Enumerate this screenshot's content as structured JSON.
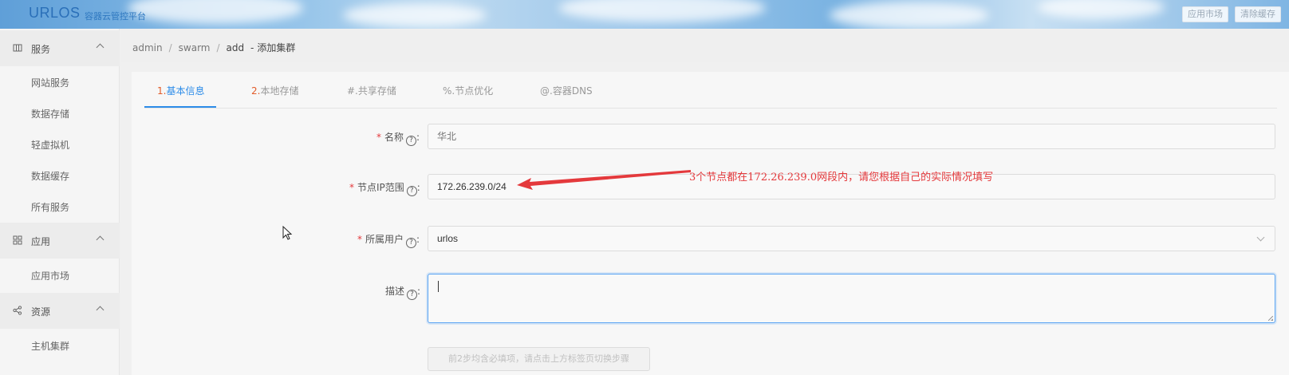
{
  "header": {
    "logo": "URLOS",
    "subtitle": "容器云管控平台",
    "buttons": [
      "应用市场",
      "清除缓存"
    ]
  },
  "sidebar": {
    "groups": [
      {
        "label": "服务",
        "icon": "service-icon",
        "items": [
          "网站服务",
          "数据存储",
          "轻虚拟机",
          "数据缓存",
          "所有服务"
        ]
      },
      {
        "label": "应用",
        "icon": "grid-icon",
        "items": [
          "应用市场"
        ]
      },
      {
        "label": "资源",
        "icon": "share-nodes-icon",
        "items": [
          "主机集群"
        ]
      }
    ]
  },
  "breadcrumb": {
    "items": [
      "admin",
      "swarm",
      "add"
    ],
    "current": "添加集群",
    "dash": "-"
  },
  "tabs": [
    {
      "num": "1.",
      "label": "基本信息",
      "active": true
    },
    {
      "num": "2.",
      "label": "本地存储",
      "active": false
    },
    {
      "num": "#.",
      "label": "共享存储",
      "active": false
    },
    {
      "num": "%.",
      "label": "节点优化",
      "active": false
    },
    {
      "num": "@.",
      "label": "容器DNS",
      "active": false
    }
  ],
  "form": {
    "name": {
      "label": "名称",
      "required": "*",
      "placeholder": "华北"
    },
    "ip_range": {
      "label": "节点IP范围",
      "required": "*",
      "value": "172.26.239.0/24"
    },
    "owner": {
      "label": "所属用户",
      "required": "*",
      "value": "urlos"
    },
    "description": {
      "label": "描述",
      "value": ""
    },
    "colon": ":",
    "help": "?",
    "submit_hint": "前2步均含必填项，请点击上方标签页切换步骤"
  },
  "annotation": {
    "text": "3个节点都在172.26.239.0网段内，请您根据自己的实际情况填写",
    "color": "#e4393c"
  },
  "colors": {
    "accent": "#2d8ce8",
    "required": "#e4393c",
    "tab_number": "#e25c2a"
  }
}
